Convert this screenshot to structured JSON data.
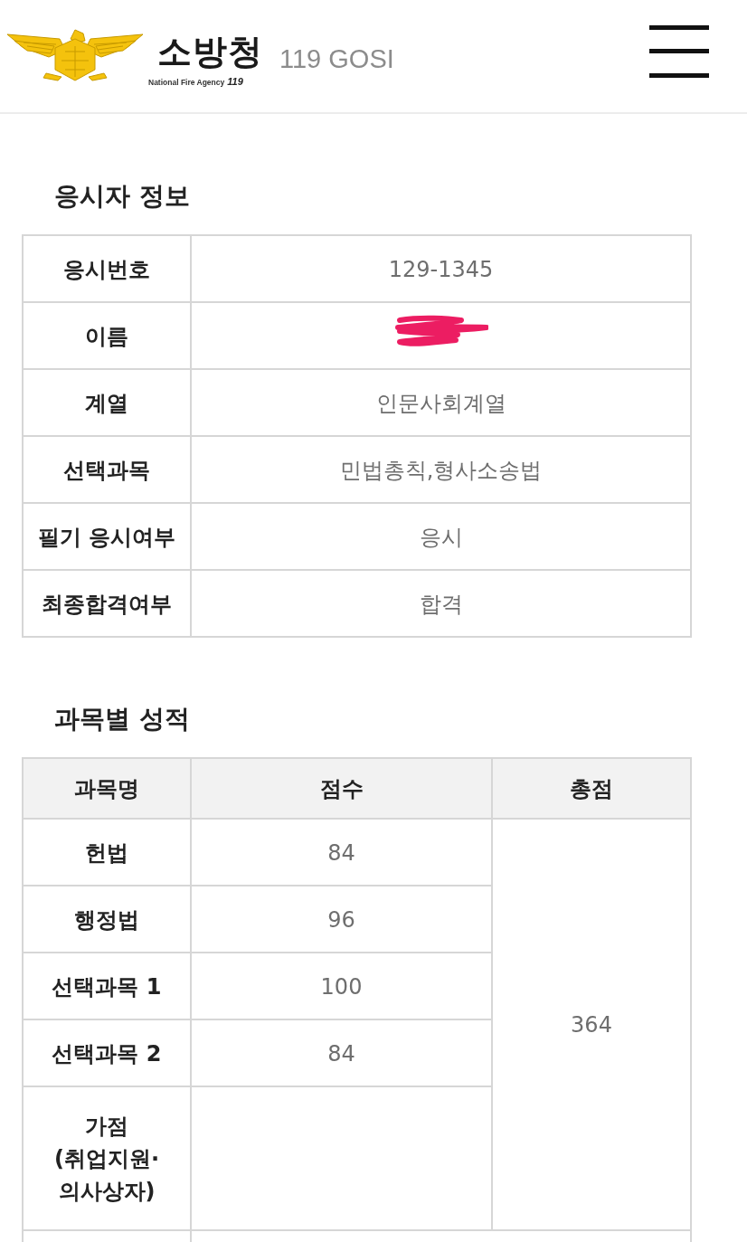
{
  "header": {
    "logo": {
      "name_ko": "소방청",
      "name_en": "National Fire Agency",
      "mark": "119"
    },
    "site_title": "119 GOSI"
  },
  "applicant_section": {
    "title": "응시자 정보",
    "rows": [
      {
        "label": "응시번호",
        "kind": "text",
        "value": "129-1345"
      },
      {
        "label": "이름",
        "kind": "redacted"
      },
      {
        "label": "계열",
        "kind": "text",
        "value": "인문사회계열"
      },
      {
        "label": "선택과목",
        "kind": "text",
        "value": "민법총칙,형사소송법"
      },
      {
        "label": "필기 응시여부",
        "kind": "text",
        "value": "응시"
      },
      {
        "label": "최종합격여부",
        "kind": "text",
        "value": "합격"
      }
    ]
  },
  "scores_section": {
    "title": "과목별 성적",
    "columns": [
      "과목명",
      "점수",
      "총점"
    ],
    "rows": [
      {
        "subject": "헌법",
        "score": "84"
      },
      {
        "subject": "행정법",
        "score": "96"
      },
      {
        "subject": "선택과목 1",
        "score": "100"
      },
      {
        "subject": "선택과목 2",
        "score": "84"
      },
      {
        "subject": "가점\n(취업지원·\n의사상자)"
      }
    ],
    "total": "364"
  }
}
